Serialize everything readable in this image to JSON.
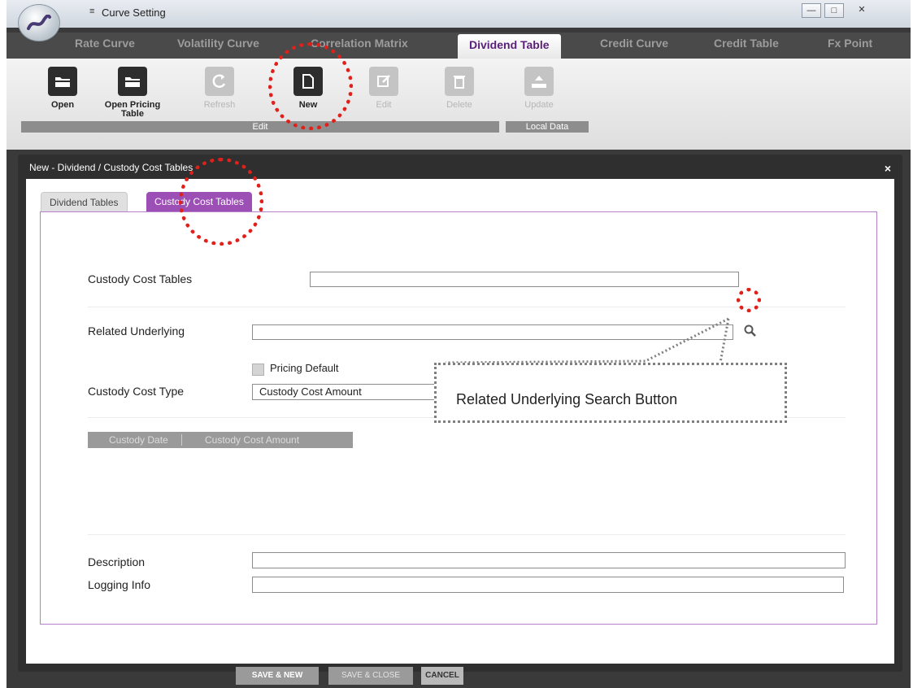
{
  "window": {
    "title": "Curve Setting",
    "quick_access": "≡",
    "min_glyph": "—",
    "max_glyph": "□",
    "close_glyph": "✕"
  },
  "tabs": [
    {
      "label": "Rate Curve"
    },
    {
      "label": "Volatility Curve"
    },
    {
      "label": "Correlation Matrix"
    },
    {
      "label": "Dividend Table",
      "active": true
    },
    {
      "label": "Credit Curve"
    },
    {
      "label": "Credit Table"
    },
    {
      "label": "Fx Point"
    }
  ],
  "ribbon": {
    "open": "Open",
    "open_pricing_line1": "Open Pricing",
    "open_pricing_line2": "Table",
    "refresh": "Refresh",
    "new": "New",
    "edit": "Edit",
    "delete": "Delete",
    "update": "Update",
    "group_edit": "Edit",
    "group_local_data": "Local Data"
  },
  "dialog": {
    "title": "New - Dividend / Custody Cost Tables",
    "close": "×",
    "tabs": [
      "Dividend Tables",
      "Custody Cost Tables"
    ],
    "active_tab": "Custody Cost Tables",
    "fields": {
      "custody_cost_tables_label": "Custody Cost Tables",
      "custody_cost_tables_value": "",
      "related_underlying_label": "Related Underlying",
      "related_underlying_value": "",
      "pricing_default_label": "Pricing Default",
      "pricing_default_checked": false,
      "custody_cost_type_label": "Custody Cost Type",
      "custody_cost_type_value": "Custody Cost Amount",
      "description_label": "Description",
      "description_value": "",
      "logging_info_label": "Logging Info",
      "logging_info_value": ""
    },
    "grid_columns": [
      "Custody Date",
      "Custody Cost Amount"
    ],
    "buttons": {
      "save_new": "SAVE & NEW",
      "save_close": "SAVE & CLOSE",
      "cancel": "CANCEL"
    }
  },
  "annotation": {
    "callout_text": "Related Underlying Search Button"
  },
  "colors": {
    "accent_purple": "#9c4fb5",
    "active_tab_text": "#5a1f7a",
    "highlight_red": "#e0201b"
  }
}
